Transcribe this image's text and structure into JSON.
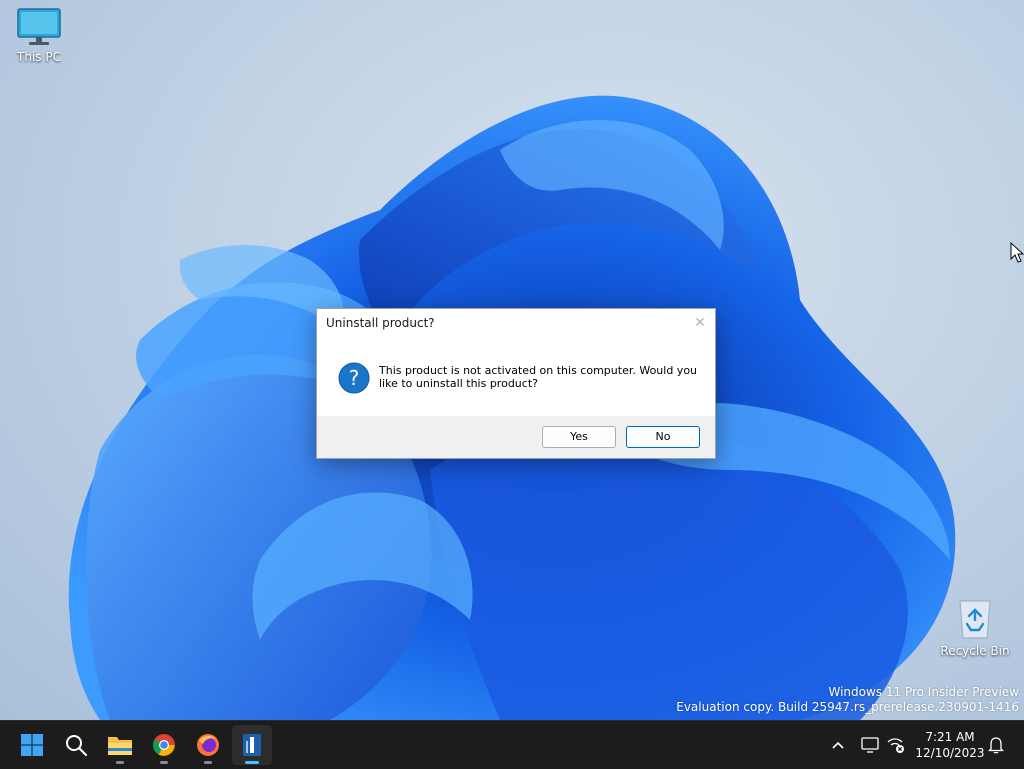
{
  "desktop": {
    "icons": [
      {
        "label": "This PC"
      },
      {
        "label": "Recycle Bin"
      }
    ],
    "watermark": {
      "line1": "Windows 11 Pro Insider Preview",
      "line2": "Evaluation copy. Build 25947.rs_prerelease.230901-1416"
    }
  },
  "dialog": {
    "title": "Uninstall product?",
    "close_label": "✕",
    "icon": "question-icon",
    "message": "This product is not activated on this computer.  Would you like to uninstall this product?",
    "buttons": {
      "yes": "Yes",
      "no": "No"
    }
  },
  "taskbar": {
    "items": [
      {
        "name": "start-icon"
      },
      {
        "name": "search-icon"
      },
      {
        "name": "file-explorer-icon"
      },
      {
        "name": "chrome-icon"
      },
      {
        "name": "firefox-icon"
      },
      {
        "name": "installer-app-icon",
        "active": true
      }
    ],
    "tray": [
      "chevron-up-icon",
      "display-icon",
      "network-disconnected-icon",
      "notification-bell-icon"
    ],
    "clock": {
      "time": "7:21 AM",
      "date": "12/10/2023"
    }
  },
  "colors": {
    "accent": "#0067c0",
    "bloom_dark": "#0a3fb8",
    "bloom_light": "#2f8bff",
    "taskbar": "#1c1c1c"
  }
}
